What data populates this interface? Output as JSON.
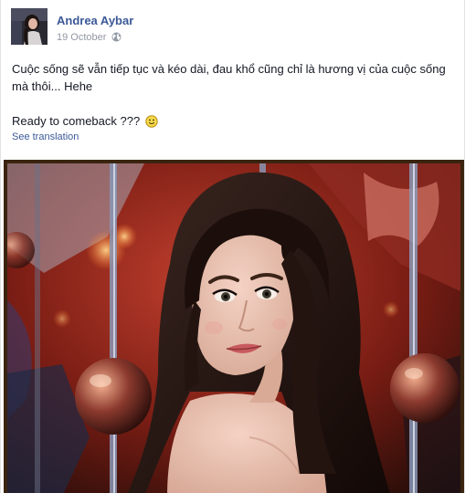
{
  "post": {
    "author": "Andrea Aybar",
    "date": "19 October",
    "privacy_icon": "globe-icon",
    "lines": [
      "Cuộc sống sẽ vẫn tiếp tục và kéo dài, đau khổ cũng chỉ là hương vị của cuộc sống mà thôi... Hehe",
      "Ready to comeback ???"
    ],
    "emoticon": "smiley-icon",
    "see_translation": "See translation"
  },
  "colors": {
    "link": "#3b5998",
    "meta": "#9197a3",
    "text": "#141823",
    "photo_frame": "#3a2410"
  }
}
